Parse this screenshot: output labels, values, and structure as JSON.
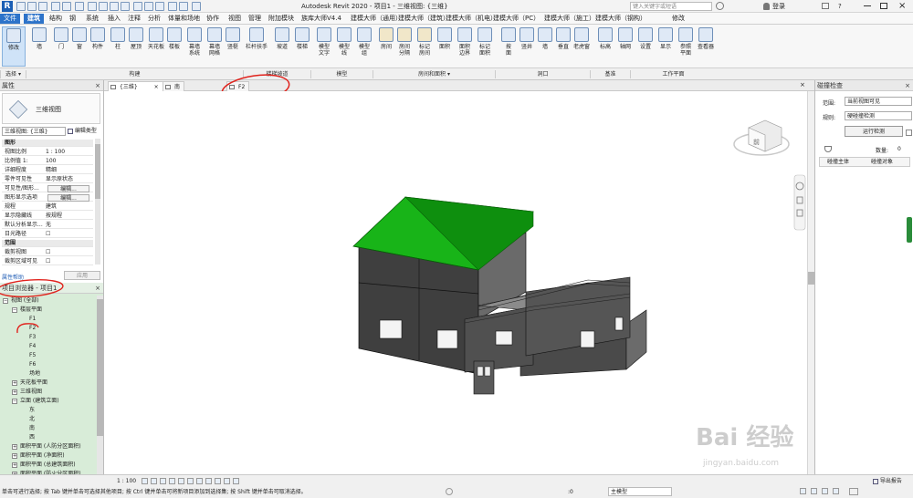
{
  "title_bar": {
    "title": "Autodesk Revit 2020 - 项目1 - 三维视图: {三维}",
    "search_placeholder": "键入关键字或短语",
    "login": "登录",
    "help": "?"
  },
  "menu_tabs": [
    "文件",
    "建筑",
    "结构",
    "钢",
    "系统",
    "插入",
    "注释",
    "分析",
    "体量和场地",
    "协作",
    "视图",
    "管理",
    "附加模块",
    "族库大师V4.4",
    "建模大师（通用）",
    "建模大师（建筑）",
    "建模大师（机电）",
    "建模大师（PC）",
    "建模大师（施工）",
    "建模大师（钢构）",
    "修改"
  ],
  "ribbon_buttons": [
    {
      "label": "修改"
    },
    {
      "label": "墙"
    },
    {
      "label": "门"
    },
    {
      "label": "窗"
    },
    {
      "label": "构件"
    },
    {
      "label": "柱"
    },
    {
      "label": "屋顶"
    },
    {
      "label": "天花板"
    },
    {
      "label": "楼板"
    },
    {
      "label": "幕墙\n系统"
    },
    {
      "label": "幕墙\n网格"
    },
    {
      "label": "竖梃"
    },
    {
      "label": "栏杆扶手"
    },
    {
      "label": "坡道"
    },
    {
      "label": "楼梯"
    },
    {
      "label": "模型\n文字"
    },
    {
      "label": "模型\n线"
    },
    {
      "label": "模型\n组"
    },
    {
      "label": "房间"
    },
    {
      "label": "房间\n分隔"
    },
    {
      "label": "标记\n房间"
    },
    {
      "label": "面积"
    },
    {
      "label": "面积\n边界"
    },
    {
      "label": "标记\n面积"
    },
    {
      "label": "按\n面"
    },
    {
      "label": "竖井"
    },
    {
      "label": "墙"
    },
    {
      "label": "垂直"
    },
    {
      "label": "老虎窗"
    },
    {
      "label": "标高"
    },
    {
      "label": "轴网"
    },
    {
      "label": "设置"
    },
    {
      "label": "显示"
    },
    {
      "label": "参照\n平面"
    },
    {
      "label": "查看器"
    }
  ],
  "ribbon_panels": [
    "选择 ▾",
    "构建",
    "楼梯坡道",
    "模型",
    "房间和面积 ▾",
    "洞口",
    "基准",
    "工作平面"
  ],
  "properties": {
    "header": "属性",
    "type_name": "三维视图",
    "selector": "三维视图: {三维}",
    "edit_type": "编辑类型",
    "rows": [
      {
        "k": "图形",
        "v": "",
        "grp": true
      },
      {
        "k": "视图比例",
        "v": "1 : 100"
      },
      {
        "k": "比例值 1:",
        "v": "100"
      },
      {
        "k": "详细程度",
        "v": "精细"
      },
      {
        "k": "零件可见性",
        "v": "显示原状态"
      },
      {
        "k": "可见性/图形...",
        "v": "编辑...",
        "btn": true
      },
      {
        "k": "图形显示选项",
        "v": "编辑...",
        "btn": true
      },
      {
        "k": "规程",
        "v": "建筑"
      },
      {
        "k": "显示隐藏线",
        "v": "按规程"
      },
      {
        "k": "默认分析显示...",
        "v": "无"
      },
      {
        "k": "日光路径",
        "v": "☐"
      },
      {
        "k": "范围",
        "v": "",
        "grp": true
      },
      {
        "k": "裁剪视图",
        "v": "☐"
      },
      {
        "k": "裁剪区域可见",
        "v": "☐"
      }
    ],
    "help_link": "属性帮助",
    "apply": "应用"
  },
  "browser": {
    "header": "项目浏览器 - 项目1",
    "items": [
      {
        "t": "视图 (全部)",
        "lv": 0,
        "tg": "−"
      },
      {
        "t": "楼层平面",
        "lv": 1,
        "tg": "−"
      },
      {
        "t": "F1",
        "lv": 2
      },
      {
        "t": "F2",
        "lv": 2
      },
      {
        "t": "F3",
        "lv": 2
      },
      {
        "t": "F4",
        "lv": 2
      },
      {
        "t": "F5",
        "lv": 2
      },
      {
        "t": "F6",
        "lv": 2
      },
      {
        "t": "场地",
        "lv": 2
      },
      {
        "t": "天花板平面",
        "lv": 1,
        "tg": "+"
      },
      {
        "t": "三维视图",
        "lv": 1,
        "tg": "+"
      },
      {
        "t": "立面 (建筑立面)",
        "lv": 1,
        "tg": "−"
      },
      {
        "t": "东",
        "lv": 2
      },
      {
        "t": "北",
        "lv": 2
      },
      {
        "t": "南",
        "lv": 2
      },
      {
        "t": "西",
        "lv": 2
      },
      {
        "t": "面积平面 (人防分区面积)",
        "lv": 1,
        "tg": "+"
      },
      {
        "t": "面积平面 (净面积)",
        "lv": 1,
        "tg": "+"
      },
      {
        "t": "面积平面 (总建筑面积)",
        "lv": 1,
        "tg": "+"
      },
      {
        "t": "面积平面 (防火分区面积)",
        "lv": 1,
        "tg": "+"
      }
    ]
  },
  "view_tabs": [
    {
      "label": "{三维}"
    },
    {
      "label": "南"
    },
    {
      "label": "F2"
    }
  ],
  "right_panel": {
    "header": "碰撞检查",
    "scope_label": "范围:",
    "scope_value": "当前视图可见",
    "rule_label": "规则:",
    "rule_value": "硬碰撞检测",
    "run_button": "运行检测",
    "count_label": "数量:",
    "count_value": "0",
    "col1": "碰撞主体",
    "col2": "碰撞对象",
    "export": "导出报告"
  },
  "view_control": {
    "scale": "1 : 100"
  },
  "status": {
    "text": "单击可进行选择; 按 Tab 键并单击可选择其他项目; 按 Ctrl 键并单击可将新项目添加到选择集; 按 Shift 键并单击可取消选择。",
    "coord": ":0",
    "model": "主模型"
  },
  "watermark": {
    "brand": "Bai 经验",
    "url": "jingyan.baidu.com"
  },
  "nav_cube": {
    "label": "前"
  }
}
